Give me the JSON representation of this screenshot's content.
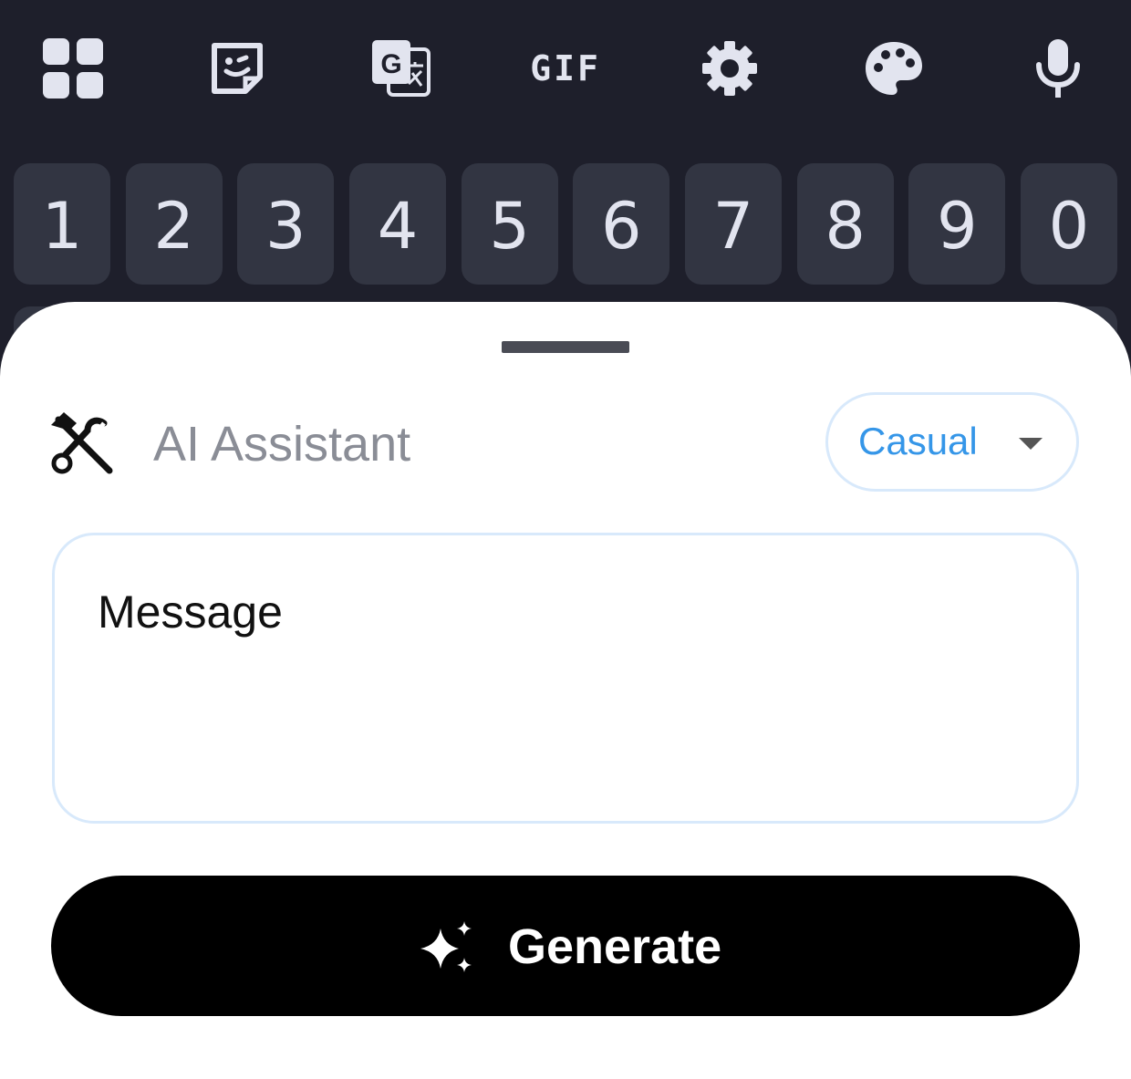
{
  "toolbar": {
    "icons": [
      "apps-grid-icon",
      "sticker-icon",
      "translate-icon",
      "gif-icon",
      "settings-gear-icon",
      "theme-palette-icon",
      "microphone-icon"
    ],
    "gif_label": "GIF"
  },
  "number_row": [
    "1",
    "2",
    "3",
    "4",
    "5",
    "6",
    "7",
    "8",
    "9",
    "0"
  ],
  "assistant": {
    "title": "AI Assistant",
    "title_icon": "tools-icon",
    "tone_selected": "Casual",
    "message_placeholder": "Message",
    "generate_label": "Generate",
    "generate_icon": "sparkle-icon"
  },
  "colors": {
    "keyboard_bg": "#1e1f2b",
    "key_bg": "#323542",
    "accent": "#3596e8",
    "button_bg": "#000000"
  }
}
